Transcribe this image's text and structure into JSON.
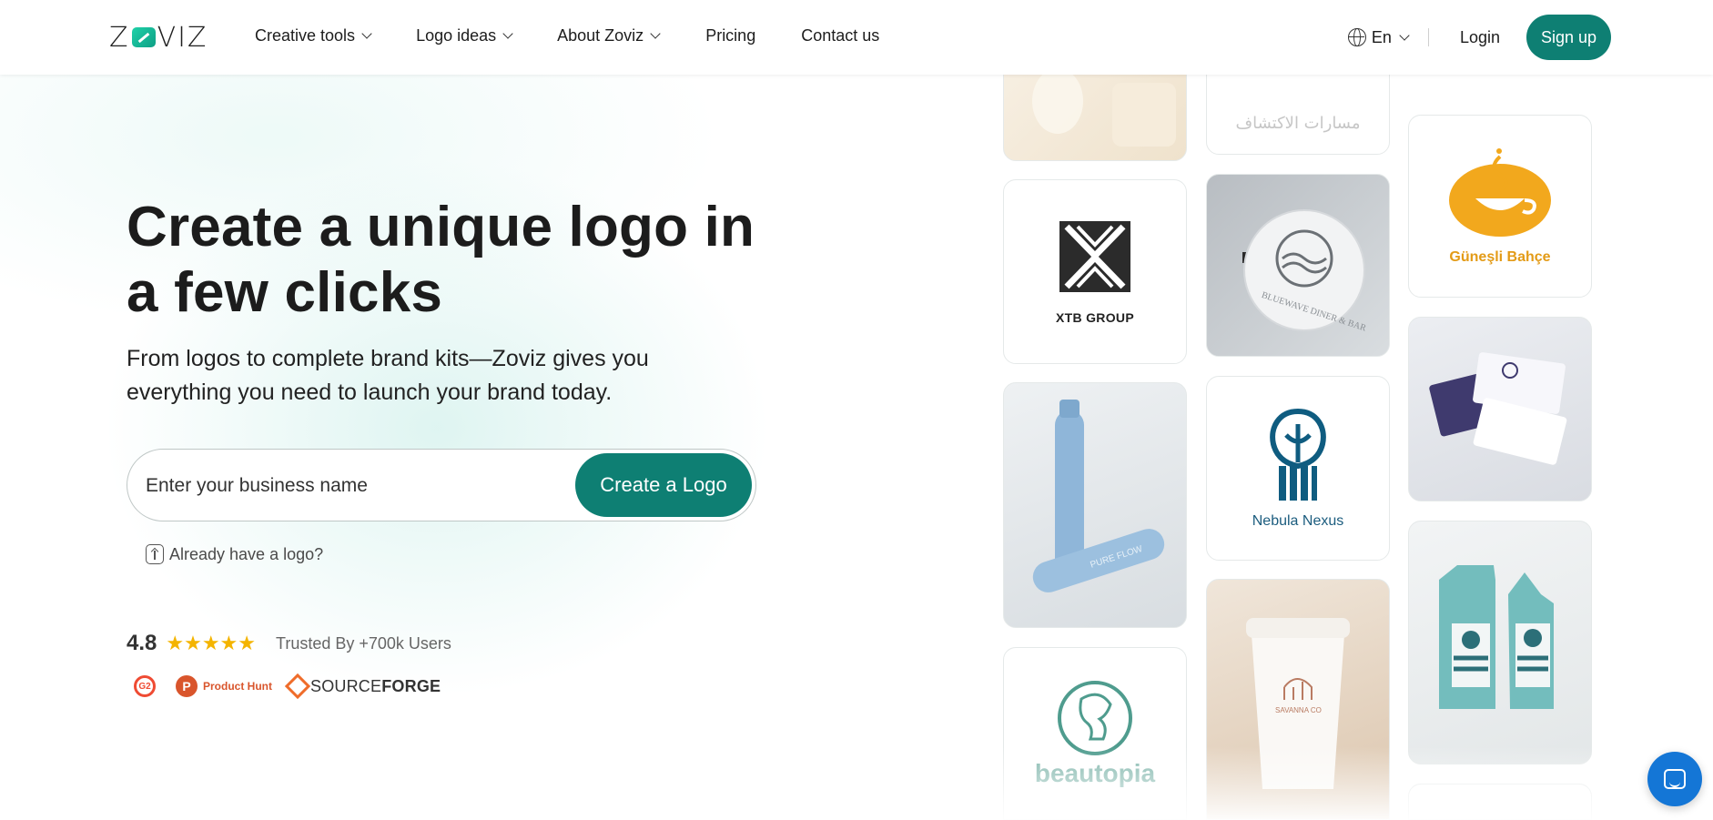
{
  "header": {
    "logo_text_left": "Z",
    "logo_text_right": "VIZ",
    "nav": [
      {
        "label": "Creative tools",
        "dropdown": true
      },
      {
        "label": "Logo ideas",
        "dropdown": true
      },
      {
        "label": "About Zoviz",
        "dropdown": true
      },
      {
        "label": "Pricing",
        "dropdown": false
      },
      {
        "label": "Contact us",
        "dropdown": false
      }
    ],
    "language": "En",
    "login": "Login",
    "signup": "Sign up"
  },
  "hero": {
    "title": "Create a unique logo in a few clicks",
    "subtitle": "From logos to complete brand kits—Zoviz gives you everything you need to launch your brand today.",
    "input_placeholder": "Enter your business name",
    "cta": "Create a Logo",
    "have_logo": "Already have a logo?"
  },
  "social_proof": {
    "rating": "4.8",
    "stars": "★★★★★",
    "trusted": "Trusted By +700k Users",
    "badges": {
      "g2": "G2",
      "producthunt_letter": "P",
      "producthunt": "Product Hunt",
      "sourceforge_light": "SOURCE",
      "sourceforge_bold": "FORGE"
    }
  },
  "gallery": {
    "arabic_caption": "مسارات الاكتشاف",
    "xtb": "XTB GROUP",
    "bluewave": "BLUEWAVE DINER & BAR",
    "gunesli": "Güneşli Bahçe",
    "nebula": "Nebula Nexus",
    "pureflow": "PURE FLOW",
    "beautopia": "beautopia",
    "savanna": "SAVANNA CO"
  },
  "colors": {
    "brand": "#0e7f73",
    "star": "#f4b400",
    "chat": "#1476d6"
  }
}
